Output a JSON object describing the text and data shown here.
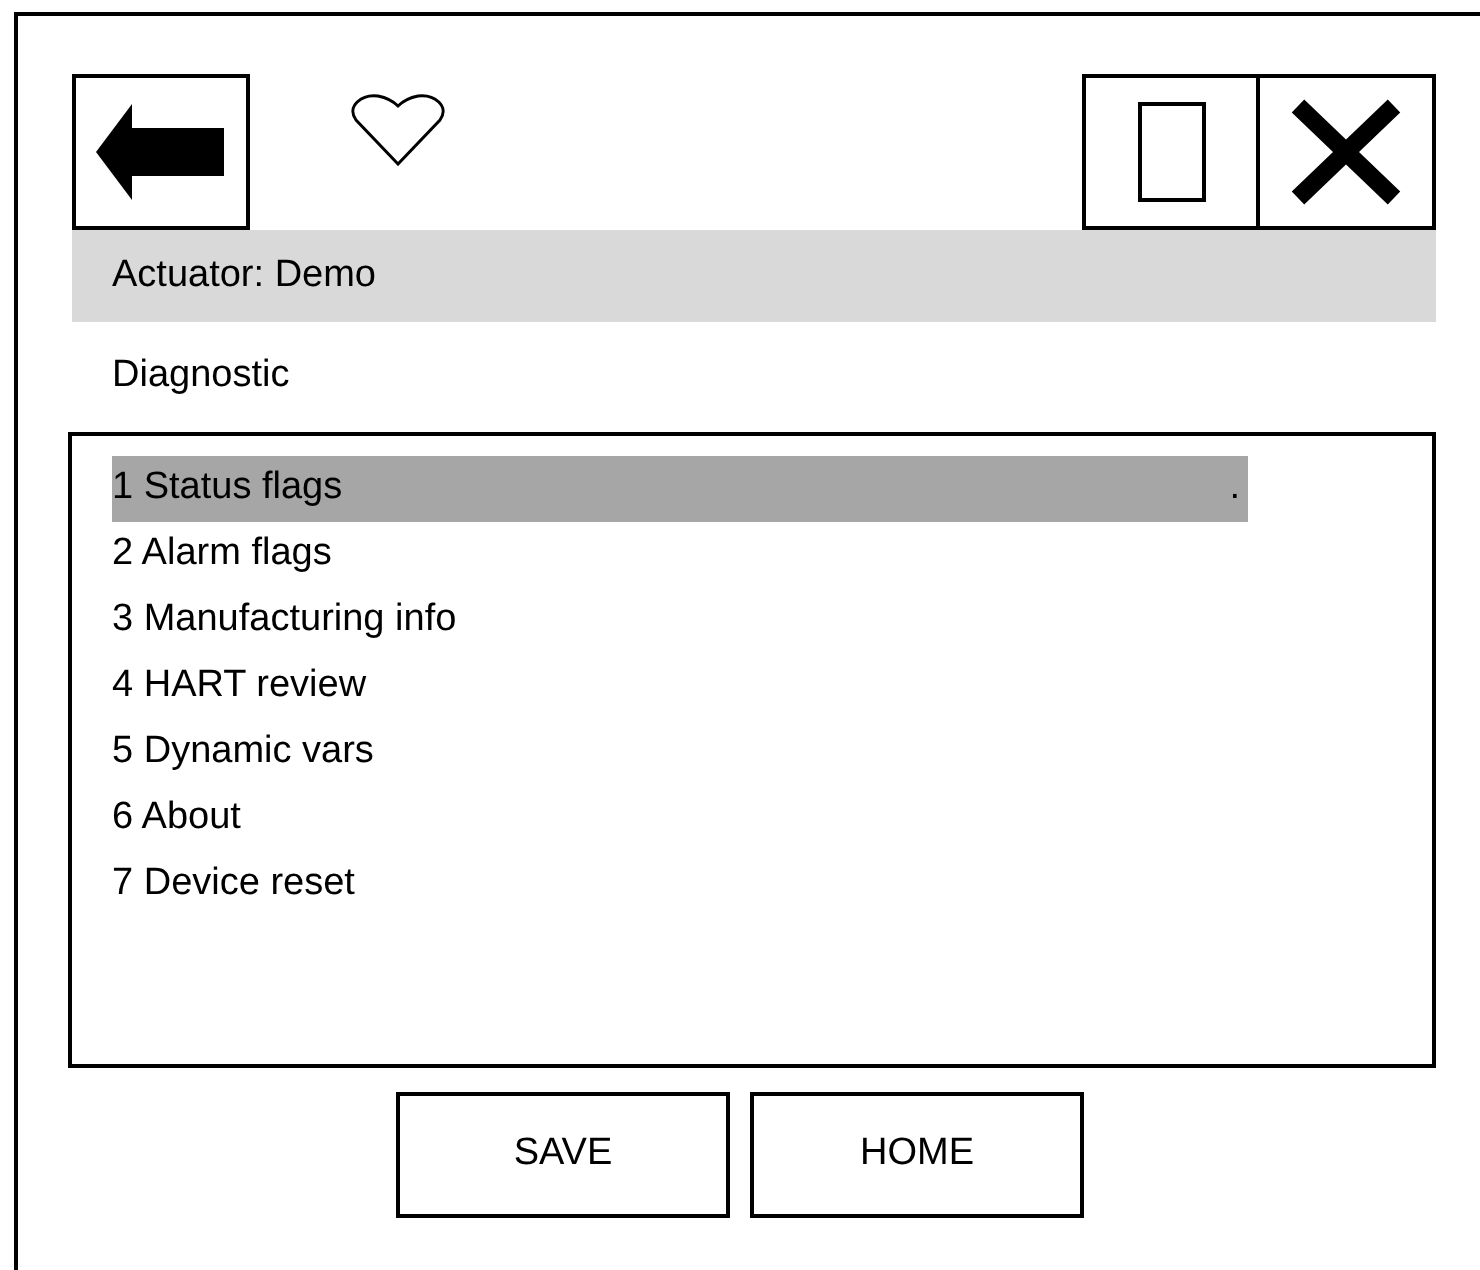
{
  "toolbar": {
    "buttons": [
      {
        "kind": "back"
      },
      {
        "kind": "favorite"
      },
      {
        "kind": "window"
      },
      {
        "kind": "close"
      }
    ]
  },
  "header": {
    "title": "Actuator: Demo"
  },
  "section": {
    "title": "Diagnostic"
  },
  "menu": {
    "items": [
      {
        "label": "1 Status flags",
        "selected": true,
        "suffix": "."
      },
      {
        "label": "2 Alarm flags",
        "selected": false
      },
      {
        "label": "3 Manufacturing info",
        "selected": false
      },
      {
        "label": "4 HART review",
        "selected": false
      },
      {
        "label": "5 Dynamic vars",
        "selected": false
      },
      {
        "label": "6 About",
        "selected": false
      },
      {
        "label": "7 Device reset",
        "selected": false
      }
    ]
  },
  "buttons": [
    "SAVE",
    "HOME"
  ]
}
